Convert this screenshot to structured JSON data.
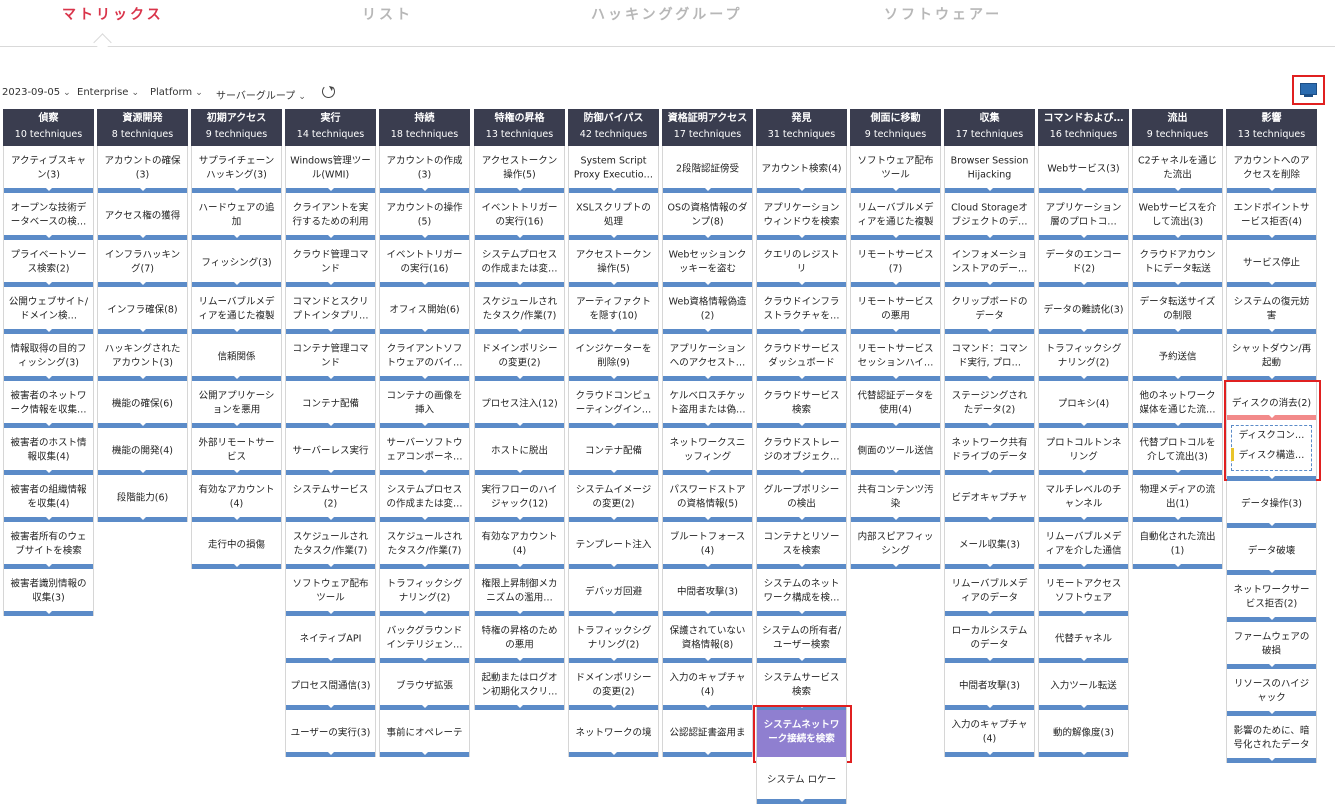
{
  "tabs": [
    "マトリックス",
    "リスト",
    "ハッキンググループ",
    "ソフトウェアー"
  ],
  "filters": [
    "2023-09-05",
    "Enterprise",
    "Platform",
    "サーバーグループ"
  ],
  "icons": {
    "filter_chevron": "chevron-down-icon",
    "refresh": "refresh-icon",
    "view_toggle": "monitor-icon"
  },
  "colors": {
    "header": "#3a3d4f",
    "bar": "#5b8bc8",
    "active_tab": "#d9344a",
    "selected": "#8f7fd0",
    "highlight": "#e02020"
  },
  "columns": [
    {
      "title": "偵察",
      "count": "10 techniques",
      "items": [
        "アクティブスキャン(3)",
        "オープンな技術データベースの検…",
        "プライベートソース検索(2)",
        "公開ウェブサイト/ドメイン検…",
        "情報取得の目的フィッシング(3)",
        "被害者のネットワーク情報を収集…",
        "被害者のホスト情報収集(4)",
        "被害者の組織情報を収集(4)",
        "被害者所有のウェブサイトを検索",
        "被害者識別情報の収集(3)"
      ]
    },
    {
      "title": "資源開発",
      "count": "8 techniques",
      "items": [
        "アカウントの確保(3)",
        "アクセス権の獲得",
        "インフラハッキング(7)",
        "インフラ確保(8)",
        "ハッキングされたアカウント(3)",
        "機能の確保(6)",
        "機能の開発(4)",
        "段階能力(6)"
      ]
    },
    {
      "title": "初期アクセス",
      "count": "9 techniques",
      "items": [
        "サプライチェーンハッキング(3)",
        "ハードウェアの追加",
        "フィッシング(3)",
        "リムーバブルメディアを通じた複製",
        "信頼関係",
        "公開アプリケーションを悪用",
        "外部リモートサービス",
        "有効なアカウント(4)",
        "走行中の損傷"
      ]
    },
    {
      "title": "実行",
      "count": "14 techniques",
      "items": [
        "Windows管理ツール(WMI)",
        "クライアントを実行するための利用",
        "クラウド管理コマンド",
        "コマンドとスクリプトインタプリ…",
        "コンテナ管理コマンド",
        "コンテナ配備",
        "サーバーレス実行",
        "システムサービス(2)",
        "スケジュールされたタスク/作業(7)",
        "ソフトウェア配布ツール",
        "ネイティブAPI",
        "プロセス間通信(3)",
        "ユーザーの実行(3)"
      ]
    },
    {
      "title": "持続",
      "count": "18 techniques",
      "items": [
        "アカウントの作成(3)",
        "アカウントの操作(5)",
        "イベントトリガーの実行(16)",
        "オフィス開始(6)",
        "クライアントソフトウェアのバイ…",
        "コンテナの画像を挿入",
        "サーバーソフトウェアコンポーネ…",
        "システムプロセスの作成または変…",
        "スケジュールされたタスク/作業(7)",
        "トラフィックシグナリング(2)",
        "バックグラウンドインテリジェン…",
        "ブラウザ拡張",
        "事前にオペレーテ"
      ]
    },
    {
      "title": "特権の昇格",
      "count": "13 techniques",
      "items": [
        "アクセストークン操作(5)",
        "イベントトリガーの実行(16)",
        "システムプロセスの作成または変…",
        "スケジュールされたタスク/作業(7)",
        "ドメインポリシーの変更(2)",
        "プロセス注入(12)",
        "ホストに脱出",
        "実行フローのハイジャック(12)",
        "有効なアカウント(4)",
        "権限上昇制御メカニズムの濫用…",
        "特権の昇格のための悪用",
        "起動またはログオン初期化スクリ…"
      ]
    },
    {
      "title": "防御バイパス",
      "count": "42 techniques",
      "items": [
        "System Script Proxy Executio…",
        "XSLスクリプトの処理",
        "アクセストークン操作(5)",
        "アーティファクトを隠す(10)",
        "インジケーターを削除(9)",
        "クラウドコンピューティングイン…",
        "コンテナ配備",
        "システムイメージの変更(2)",
        "テンプレート注入",
        "デバッガ回避",
        "トラフィックシグナリング(2)",
        "ドメインポリシーの変更(2)",
        "ネットワークの境"
      ]
    },
    {
      "title": "資格証明アクセス",
      "count": "17 techniques",
      "items": [
        "2段階認証傍受",
        "OSの資格情報のダンプ(8)",
        "Webセッションクッキーを盗む",
        "Web資格情報偽造(2)",
        "アプリケーションへのアクセスト…",
        "ケルベロスチケット盗用または偽…",
        "ネットワークスニッフィング",
        "パスワードストアの資格情報(5)",
        "ブルートフォース(4)",
        "中間者攻撃(3)",
        "保護されていない資格情報(8)",
        "入力のキャプチャ(4)",
        "公認認証書盗用ま"
      ]
    },
    {
      "title": "発見",
      "count": "31 techniques",
      "items": [
        "アカウント検索(4)",
        "アプリケーションウィンドウを検索",
        "クエリのレジストリ",
        "クラウドインフラストラクチャを…",
        "クラウドサービスダッシュボード",
        "クラウドサービス検索",
        "クラウドストレージのオブジェク…",
        "グループポリシーの検出",
        "コンテナとリソースを検索",
        "システムのネットワーク構成を検…",
        "システムの所有者/ユーザー検索",
        "システムサービス検索",
        "システムネットワーク接続を検索",
        "システム ロケー"
      ]
    },
    {
      "title": "側面に移動",
      "count": "9 techniques",
      "items": [
        "ソフトウェア配布ツール",
        "リムーバブルメディアを通じた複製",
        "リモートサービス(7)",
        "リモートサービスの悪用",
        "リモートサービスセッションハイ…",
        "代替認証データを使用(4)",
        "側面のツール送信",
        "共有コンテンツ汚染",
        "内部スピアフィッシング"
      ]
    },
    {
      "title": "収集",
      "count": "17 techniques",
      "items": [
        "Browser Session Hijacking",
        "Cloud Storageオブジェクトのデ…",
        "インフォメーションストアのデー…",
        "クリップボードのデータ",
        "コマンド：コマンド実行, プロ…",
        "ステージングされたデータ(2)",
        "ネットワーク共有ドライブのデータ",
        "ビデオキャプチャ",
        "メール収集(3)",
        "リムーバブルメディアのデータ",
        "ローカルシステムのデータ",
        "中間者攻撃(3)",
        "入力のキャプチャ(4)"
      ]
    },
    {
      "title": "コマンドおよび…",
      "count": "16 techniques",
      "items": [
        "Webサービス(3)",
        "アプリケーション層のプロトコ…",
        "データのエンコード(2)",
        "データの難読化(3)",
        "トラフィックシグナリング(2)",
        "プロキシ(4)",
        "プロトコルトンネリング",
        "マルチレベルのチャンネル",
        "リムーバブルメディアを介した通信",
        "リモートアクセスソフトウェア",
        "代替チャネル",
        "入力ツール転送",
        "動的解像度(3)"
      ]
    },
    {
      "title": "流出",
      "count": "9 techniques",
      "items": [
        "C2チャネルを通じた流出",
        "Webサービスを介して流出(3)",
        "クラウドアカウントにデータ転送",
        "データ転送サイズの制限",
        "予約送信",
        "他のネットワーク媒体を通じた流…",
        "代替プロトコルを介して流出(3)",
        "物理メディアの流出(1)",
        "自動化された流出(1)"
      ]
    },
    {
      "title": "影響",
      "count": "13 techniques",
      "items": [
        "アカウントへのアクセスを削除",
        "エンドポイントサービス拒否(4)",
        "サービス停止",
        "システムの復元妨害",
        "シャットダウン/再起動",
        "ディスクの消去(2)",
        "データ操作(3)",
        "データ破壊",
        "ネットワークサービス拒否(2)",
        "ファームウェアの破損",
        "リソースのハイジャック",
        "影響のために、暗号化されたデータ"
      ]
    }
  ],
  "disk_wipe_sub": [
    "ディスクコン…",
    "ディスク構造…"
  ]
}
